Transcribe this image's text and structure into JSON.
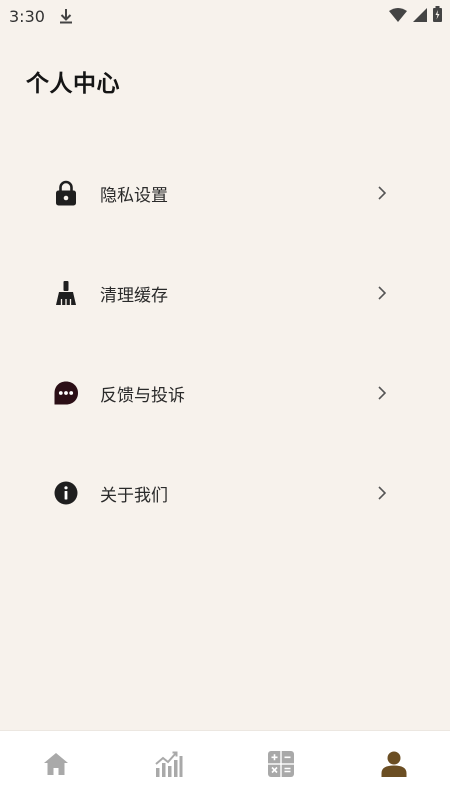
{
  "status_bar": {
    "time": "3:30"
  },
  "header": {
    "title": "个人中心"
  },
  "menu": {
    "items": [
      {
        "label": "隐私设置",
        "icon": "lock-icon"
      },
      {
        "label": "清理缓存",
        "icon": "broom-icon"
      },
      {
        "label": "反馈与投诉",
        "icon": "chat-bubble-icon"
      },
      {
        "label": "关于我们",
        "icon": "info-icon"
      }
    ]
  },
  "bottom_nav": {
    "items": [
      {
        "icon": "home-icon",
        "active": false
      },
      {
        "icon": "chart-icon",
        "active": false
      },
      {
        "icon": "calculator-icon",
        "active": false
      },
      {
        "icon": "person-icon",
        "active": true
      }
    ]
  },
  "colors": {
    "background": "#f7f2ec",
    "nav_background": "#ffffff",
    "nav_inactive": "#a9a9a9",
    "nav_active": "#6b4e23",
    "text": "#2a2a2a",
    "chat_icon": "#2b0f16"
  }
}
